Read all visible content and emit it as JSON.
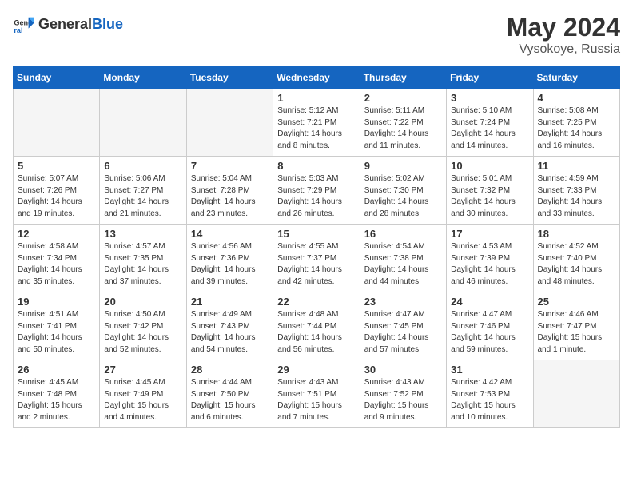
{
  "header": {
    "logo_general": "General",
    "logo_blue": "Blue",
    "month": "May 2024",
    "location": "Vysokoye, Russia"
  },
  "weekdays": [
    "Sunday",
    "Monday",
    "Tuesday",
    "Wednesday",
    "Thursday",
    "Friday",
    "Saturday"
  ],
  "weeks": [
    [
      {
        "day": "",
        "empty": true
      },
      {
        "day": "",
        "empty": true
      },
      {
        "day": "",
        "empty": true
      },
      {
        "day": "1",
        "sunrise": "5:12 AM",
        "sunset": "7:21 PM",
        "daylight": "14 hours and 8 minutes."
      },
      {
        "day": "2",
        "sunrise": "5:11 AM",
        "sunset": "7:22 PM",
        "daylight": "14 hours and 11 minutes."
      },
      {
        "day": "3",
        "sunrise": "5:10 AM",
        "sunset": "7:24 PM",
        "daylight": "14 hours and 14 minutes."
      },
      {
        "day": "4",
        "sunrise": "5:08 AM",
        "sunset": "7:25 PM",
        "daylight": "14 hours and 16 minutes."
      }
    ],
    [
      {
        "day": "5",
        "sunrise": "5:07 AM",
        "sunset": "7:26 PM",
        "daylight": "14 hours and 19 minutes."
      },
      {
        "day": "6",
        "sunrise": "5:06 AM",
        "sunset": "7:27 PM",
        "daylight": "14 hours and 21 minutes."
      },
      {
        "day": "7",
        "sunrise": "5:04 AM",
        "sunset": "7:28 PM",
        "daylight": "14 hours and 23 minutes."
      },
      {
        "day": "8",
        "sunrise": "5:03 AM",
        "sunset": "7:29 PM",
        "daylight": "14 hours and 26 minutes."
      },
      {
        "day": "9",
        "sunrise": "5:02 AM",
        "sunset": "7:30 PM",
        "daylight": "14 hours and 28 minutes."
      },
      {
        "day": "10",
        "sunrise": "5:01 AM",
        "sunset": "7:32 PM",
        "daylight": "14 hours and 30 minutes."
      },
      {
        "day": "11",
        "sunrise": "4:59 AM",
        "sunset": "7:33 PM",
        "daylight": "14 hours and 33 minutes."
      }
    ],
    [
      {
        "day": "12",
        "sunrise": "4:58 AM",
        "sunset": "7:34 PM",
        "daylight": "14 hours and 35 minutes."
      },
      {
        "day": "13",
        "sunrise": "4:57 AM",
        "sunset": "7:35 PM",
        "daylight": "14 hours and 37 minutes."
      },
      {
        "day": "14",
        "sunrise": "4:56 AM",
        "sunset": "7:36 PM",
        "daylight": "14 hours and 39 minutes."
      },
      {
        "day": "15",
        "sunrise": "4:55 AM",
        "sunset": "7:37 PM",
        "daylight": "14 hours and 42 minutes."
      },
      {
        "day": "16",
        "sunrise": "4:54 AM",
        "sunset": "7:38 PM",
        "daylight": "14 hours and 44 minutes."
      },
      {
        "day": "17",
        "sunrise": "4:53 AM",
        "sunset": "7:39 PM",
        "daylight": "14 hours and 46 minutes."
      },
      {
        "day": "18",
        "sunrise": "4:52 AM",
        "sunset": "7:40 PM",
        "daylight": "14 hours and 48 minutes."
      }
    ],
    [
      {
        "day": "19",
        "sunrise": "4:51 AM",
        "sunset": "7:41 PM",
        "daylight": "14 hours and 50 minutes."
      },
      {
        "day": "20",
        "sunrise": "4:50 AM",
        "sunset": "7:42 PM",
        "daylight": "14 hours and 52 minutes."
      },
      {
        "day": "21",
        "sunrise": "4:49 AM",
        "sunset": "7:43 PM",
        "daylight": "14 hours and 54 minutes."
      },
      {
        "day": "22",
        "sunrise": "4:48 AM",
        "sunset": "7:44 PM",
        "daylight": "14 hours and 56 minutes."
      },
      {
        "day": "23",
        "sunrise": "4:47 AM",
        "sunset": "7:45 PM",
        "daylight": "14 hours and 57 minutes."
      },
      {
        "day": "24",
        "sunrise": "4:47 AM",
        "sunset": "7:46 PM",
        "daylight": "14 hours and 59 minutes."
      },
      {
        "day": "25",
        "sunrise": "4:46 AM",
        "sunset": "7:47 PM",
        "daylight": "15 hours and 1 minute."
      }
    ],
    [
      {
        "day": "26",
        "sunrise": "4:45 AM",
        "sunset": "7:48 PM",
        "daylight": "15 hours and 2 minutes."
      },
      {
        "day": "27",
        "sunrise": "4:45 AM",
        "sunset": "7:49 PM",
        "daylight": "15 hours and 4 minutes."
      },
      {
        "day": "28",
        "sunrise": "4:44 AM",
        "sunset": "7:50 PM",
        "daylight": "15 hours and 6 minutes."
      },
      {
        "day": "29",
        "sunrise": "4:43 AM",
        "sunset": "7:51 PM",
        "daylight": "15 hours and 7 minutes."
      },
      {
        "day": "30",
        "sunrise": "4:43 AM",
        "sunset": "7:52 PM",
        "daylight": "15 hours and 9 minutes."
      },
      {
        "day": "31",
        "sunrise": "4:42 AM",
        "sunset": "7:53 PM",
        "daylight": "15 hours and 10 minutes."
      },
      {
        "day": "",
        "empty": true
      }
    ]
  ]
}
